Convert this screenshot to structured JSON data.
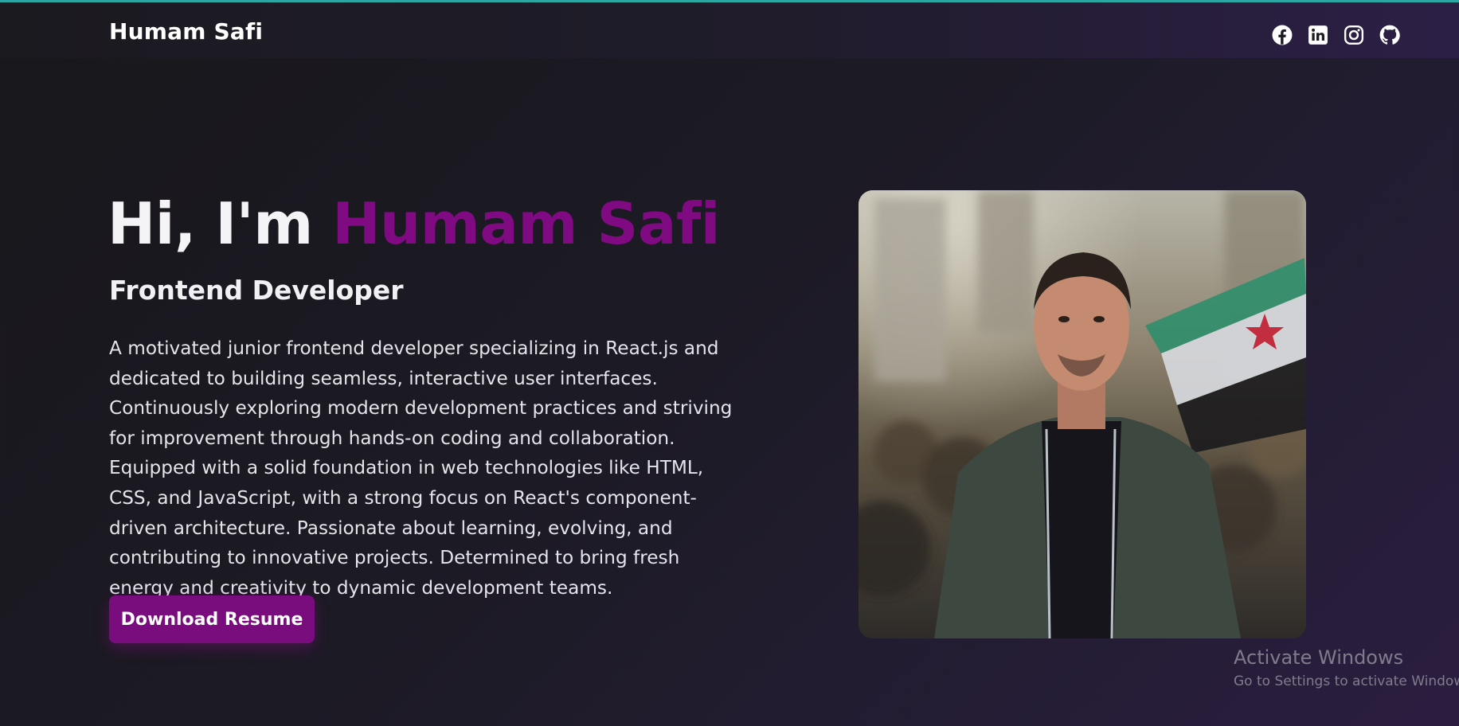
{
  "header": {
    "brand": "Humam Safi",
    "socials": [
      {
        "icon": "facebook-icon"
      },
      {
        "icon": "linkedin-icon"
      },
      {
        "icon": "instagram-icon"
      },
      {
        "icon": "github-icon"
      }
    ]
  },
  "hero": {
    "greeting": "Hi, I'm ",
    "name": "Humam Safi",
    "role": "Frontend Developer",
    "bio": "A motivated junior frontend developer specializing in React.js and dedicated to building seamless, interactive user interfaces. Continuously exploring modern development practices and striving for improvement through hands-on coding and collaboration. Equipped with a solid foundation in web technologies like HTML, CSS, and JavaScript, with a strong focus on React's component-driven architecture. Passionate about learning, evolving, and contributing to innovative projects. Determined to bring fresh energy and creativity to dynamic development teams.",
    "download_label": "Download Resume"
  },
  "colors": {
    "accent": "#7f0a82",
    "button": "#7a0d7d",
    "top_line": "#2aa7a3"
  },
  "watermark": {
    "title": "Activate Windows",
    "subtitle": "Go to Settings to activate Windows."
  }
}
